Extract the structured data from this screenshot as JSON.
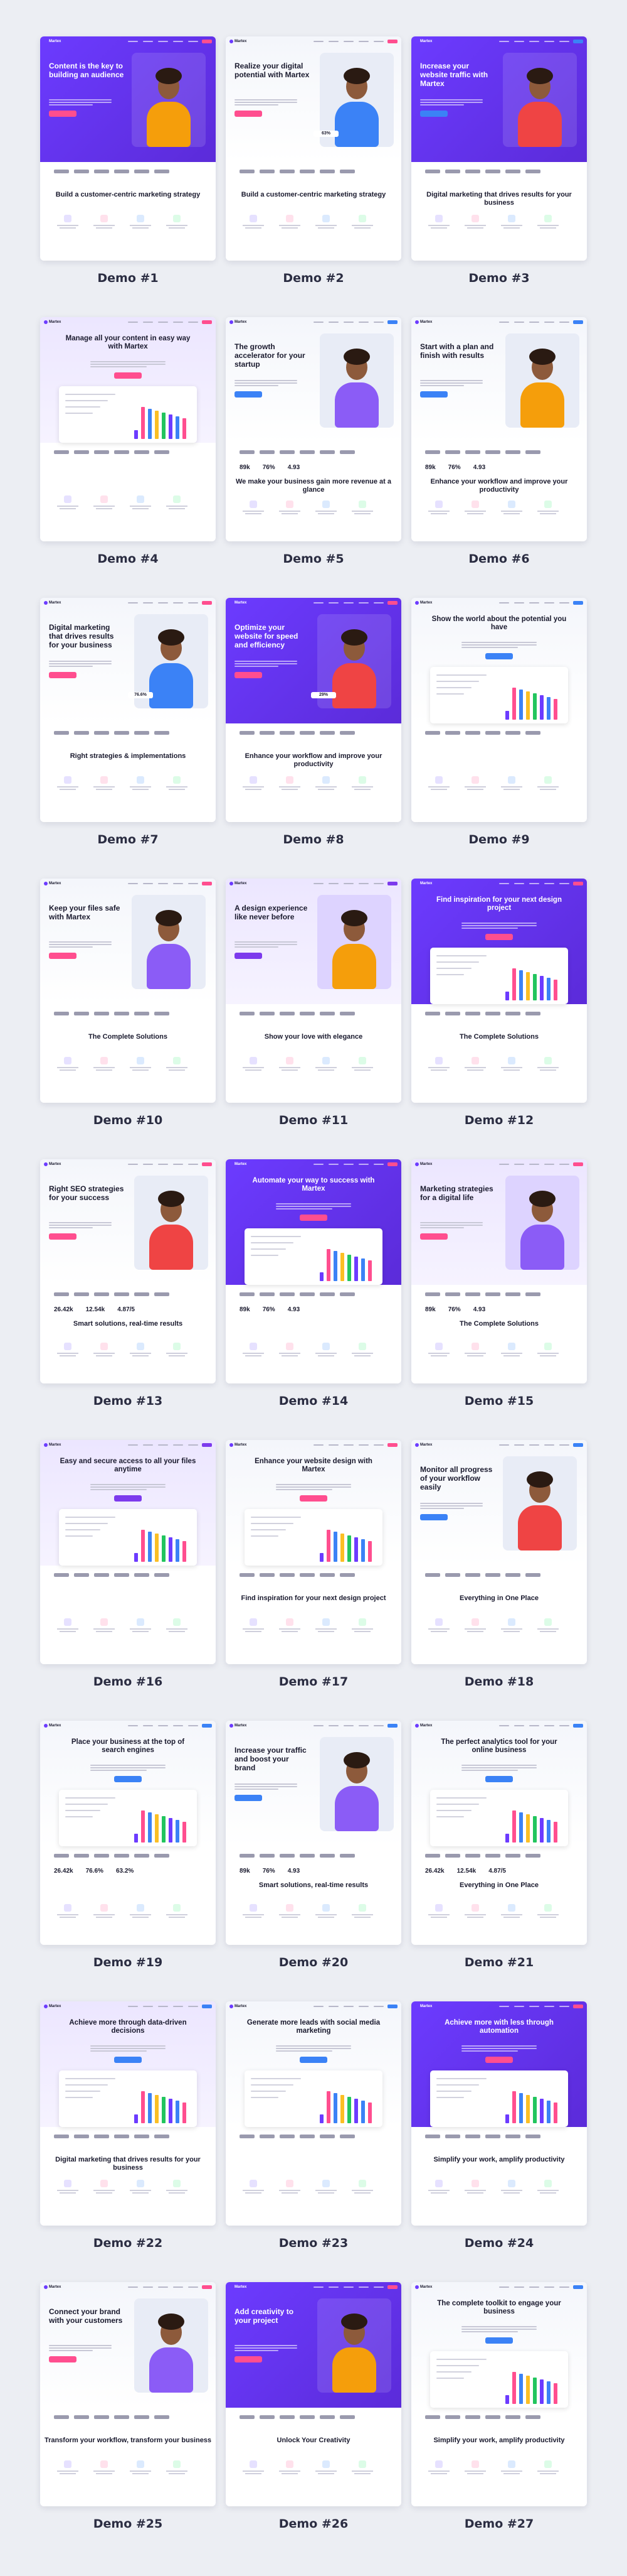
{
  "demos": [
    {
      "label": "Demo #1",
      "title": "Content is the key to building an audience",
      "section": "Build a customer-centric marketing strategy",
      "variant": "purple-left",
      "accent": "#ff4e8f"
    },
    {
      "label": "Demo #2",
      "title": "Realize your digital potential with Martex",
      "section": "Build a customer-centric marketing strategy",
      "variant": "light-right",
      "accent": "#ff4e8f",
      "stat": "63%"
    },
    {
      "label": "Demo #3",
      "title": "Increase your website traffic with Martex",
      "section": "Digital marketing that drives results for your business",
      "variant": "purple-left",
      "accent": "#3b82f6"
    },
    {
      "label": "Demo #4",
      "title": "Manage all your content in easy way with Martex",
      "section": "",
      "variant": "lavender-center",
      "accent": "#ff4e8f"
    },
    {
      "label": "Demo #5",
      "title": "The growth accelerator for your startup",
      "section": "We make your business gain more revenue at a glance",
      "variant": "light-right",
      "accent": "#3b82f6",
      "stats": [
        "89k",
        "76%",
        "4.93"
      ]
    },
    {
      "label": "Demo #6",
      "title": "Start with a plan and finish with results",
      "section": "Enhance your workflow and improve your productivity",
      "variant": "light-right",
      "accent": "#3b82f6",
      "stats": [
        "89k",
        "76%",
        "4.93"
      ]
    },
    {
      "label": "Demo #7",
      "title": "Digital marketing that drives results for your business",
      "section": "Right strategies & implementations",
      "variant": "light-right",
      "accent": "#ff4e8f",
      "stat": "76.6%"
    },
    {
      "label": "Demo #8",
      "title": "Optimize your website for speed and efficiency",
      "section": "Enhance your workflow and improve your productivity",
      "variant": "purple-left",
      "accent": "#ff4e8f",
      "stat": "29%"
    },
    {
      "label": "Demo #9",
      "title": "Show the world about the potential you have",
      "section": "",
      "variant": "light-center",
      "accent": "#3b82f6"
    },
    {
      "label": "Demo #10",
      "title": "Keep your files safe with Martex",
      "section": "The Complete Solutions",
      "variant": "light-left",
      "accent": "#ff4e8f"
    },
    {
      "label": "Demo #11",
      "title": "A design experience like never before",
      "section": "Show your love with elegance",
      "variant": "lavender-left",
      "accent": "#7c3aed"
    },
    {
      "label": "Demo #12",
      "title": "Find inspiration for your next design project",
      "section": "The Complete Solutions",
      "variant": "purple-center",
      "accent": "#ff4e8f"
    },
    {
      "label": "Demo #13",
      "title": "Right SEO strategies for your success",
      "section": "Smart solutions, real-time results",
      "variant": "light-right",
      "accent": "#ff4e8f",
      "stats": [
        "26.42k",
        "12.54k",
        "4.87/5"
      ]
    },
    {
      "label": "Demo #14",
      "title": "Automate your way to success with Martex",
      "section": "",
      "variant": "purple-center",
      "accent": "#ff4e8f",
      "stats": [
        "89k",
        "76%",
        "4.93"
      ]
    },
    {
      "label": "Demo #15",
      "title": "Marketing strategies for a digital life",
      "section": "The Complete Solutions",
      "variant": "lavender-right",
      "accent": "#ff4e8f",
      "stats": [
        "89k",
        "76%",
        "4.93"
      ]
    },
    {
      "label": "Demo #16",
      "title": "Easy and secure access to all your files anytime",
      "section": "",
      "variant": "lavender-center",
      "accent": "#7c3aed"
    },
    {
      "label": "Demo #17",
      "title": "Enhance your website design with Martex",
      "section": "Find inspiration for your next design project",
      "variant": "light-center",
      "accent": "#ff4e8f"
    },
    {
      "label": "Demo #18",
      "title": "Monitor all progress of your workflow easily",
      "section": "Everything in One Place",
      "variant": "light-left",
      "accent": "#3b82f6"
    },
    {
      "label": "Demo #19",
      "title": "Place your business at the top of search engines",
      "section": "",
      "variant": "light-center",
      "accent": "#3b82f6",
      "stats": [
        "26.42k",
        "76.6%",
        "63.2%"
      ]
    },
    {
      "label": "Demo #20",
      "title": "Increase your traffic and boost your brand",
      "section": "Smart solutions, real-time results",
      "variant": "light-right",
      "accent": "#3b82f6",
      "stats": [
        "89k",
        "76%",
        "4.93"
      ]
    },
    {
      "label": "Demo #21",
      "title": "The perfect analytics tool for your online business",
      "section": "Everything in One Place",
      "variant": "light-center",
      "accent": "#3b82f6",
      "stats": [
        "26.42k",
        "12.54k",
        "4.87/5"
      ]
    },
    {
      "label": "Demo #22",
      "title": "Achieve more through data-driven decisions",
      "section": "Digital marketing that drives results for your business",
      "variant": "lavender-center",
      "accent": "#3b82f6"
    },
    {
      "label": "Demo #23",
      "title": "Generate more leads with social media marketing",
      "section": "",
      "variant": "light-center",
      "accent": "#3b82f6"
    },
    {
      "label": "Demo #24",
      "title": "Achieve more with less through automation",
      "section": "Simplify your work, amplify productivity",
      "variant": "purple-center",
      "accent": "#ff4e8f"
    },
    {
      "label": "Demo #25",
      "title": "Connect your brand with your customers",
      "section": "Transform your workflow, transform your business",
      "variant": "light-right",
      "accent": "#ff4e8f"
    },
    {
      "label": "Demo #26",
      "title": "Add creativity to your project",
      "section": "Unlock Your Creativity",
      "variant": "purple-left",
      "accent": "#ff4e8f"
    },
    {
      "label": "Demo #27",
      "title": "The complete toolkit to engage your business",
      "section": "Simplify your work, amplify productivity",
      "variant": "light-center",
      "accent": "#3b82f6"
    }
  ],
  "brand": "Martex",
  "colors": {
    "purple": "#6c3bff",
    "purple_dark": "#5b2bd9",
    "lavender": "#ece6ff",
    "pink": "#ff4e8f",
    "blue": "#3b82f6",
    "text": "#1a1a2e"
  }
}
